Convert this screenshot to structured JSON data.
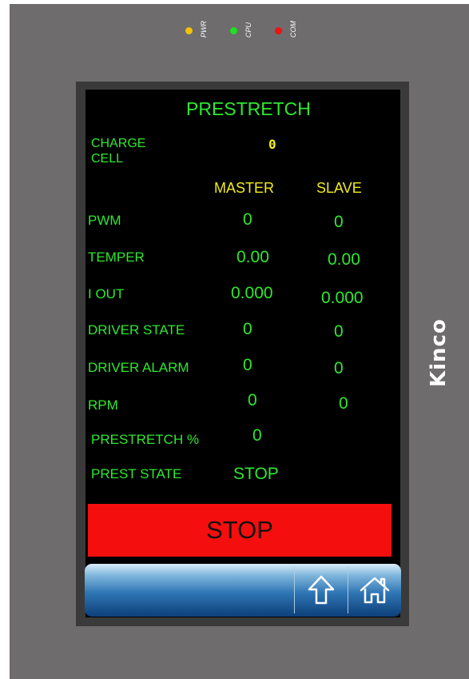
{
  "leds": [
    {
      "label": "PWR",
      "color": "#f5c000"
    },
    {
      "label": "CPU",
      "color": "#20e020"
    },
    {
      "label": "COM",
      "color": "#ee1111"
    }
  ],
  "brand": "Kinco",
  "screen": {
    "title": "PRESTRETCH",
    "charge_cell": {
      "label_line1": "CHARGE",
      "label_line2": "CELL",
      "value": "0"
    },
    "headers": {
      "master": "MASTER",
      "slave": "SLAVE"
    },
    "rows": [
      {
        "label": "PWM",
        "master": "0",
        "slave": "0"
      },
      {
        "label": "TEMPER",
        "master": "0.00",
        "slave": "0.00"
      },
      {
        "label": "I OUT",
        "master": "0.000",
        "slave": "0.000"
      },
      {
        "label": "DRIVER STATE",
        "master": "0",
        "slave": "0"
      },
      {
        "label": "DRIVER ALARM",
        "master": "0",
        "slave": "0"
      },
      {
        "label": "RPM",
        "master": "0",
        "slave": "0"
      }
    ],
    "prestretch_pct": {
      "label": "PRESTRETCH %",
      "value": "0"
    },
    "prest_state": {
      "label": "PREST STATE",
      "value": "STOP"
    },
    "stop_button": "STOP"
  },
  "navbar": {
    "icons": [
      "up-arrow-icon",
      "home-icon"
    ]
  },
  "colors": {
    "panel": "#6e6c6d",
    "label_green": "#2ee82e",
    "header_yellow": "#f3ec1c",
    "stop_red": "#f50e0e"
  }
}
